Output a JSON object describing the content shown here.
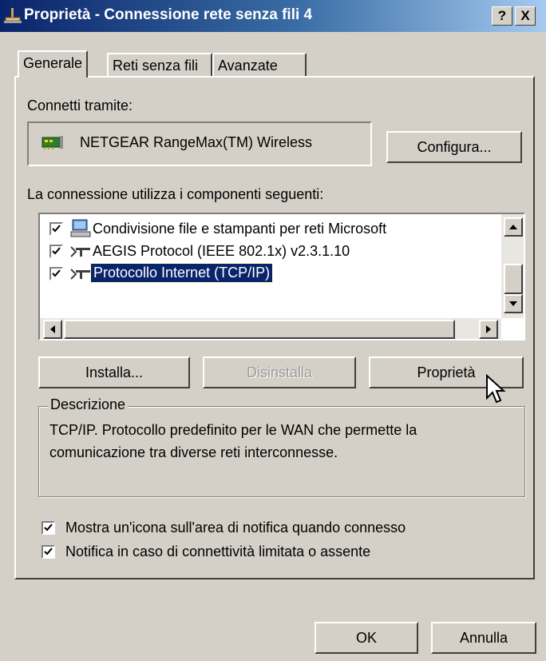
{
  "window": {
    "title": "Proprietà - Connessione rete senza fili 4",
    "help": "?",
    "close": "X"
  },
  "tabs": [
    {
      "label": "Generale",
      "active": true
    },
    {
      "label": "Reti senza fili",
      "active": false
    },
    {
      "label": "Avanzate",
      "active": false
    }
  ],
  "connect_via": {
    "label": "Connetti tramite:",
    "adapter": "NETGEAR RangeMax(TM) Wireless",
    "configure_button": "Configura..."
  },
  "components": {
    "label": "La connessione utilizza i componenti seguenti:",
    "items": [
      {
        "label": "Condivisione file e stampanti per reti Microsoft",
        "checked": true,
        "icon": "computer-icon",
        "selected": false
      },
      {
        "label": "AEGIS Protocol (IEEE 802.1x) v2.3.1.10",
        "checked": true,
        "icon": "network-protocol-icon",
        "selected": false
      },
      {
        "label": "Protocollo Internet (TCP/IP)",
        "checked": true,
        "icon": "network-protocol-icon",
        "selected": true
      }
    ]
  },
  "buttons": {
    "install": "Installa...",
    "uninstall": "Disinstalla",
    "properties": "Proprietà"
  },
  "description": {
    "title": "Descrizione",
    "text_line1": "TCP/IP. Protocollo predefinito per le WAN che permette la",
    "text_line2": "comunicazione tra diverse reti interconnesse."
  },
  "options": {
    "show_icon": {
      "label": "Mostra un'icona sull'area di notifica quando connesso",
      "checked": true
    },
    "notify_limited": {
      "label": "Notifica in caso di connettività limitata o assente",
      "checked": true
    }
  },
  "footer": {
    "ok": "OK",
    "cancel": "Annulla"
  },
  "colors": {
    "titlebar_start": "#0a246a",
    "titlebar_end": "#a6caf0",
    "face": "#d4d0c8",
    "selection": "#0a246a"
  }
}
